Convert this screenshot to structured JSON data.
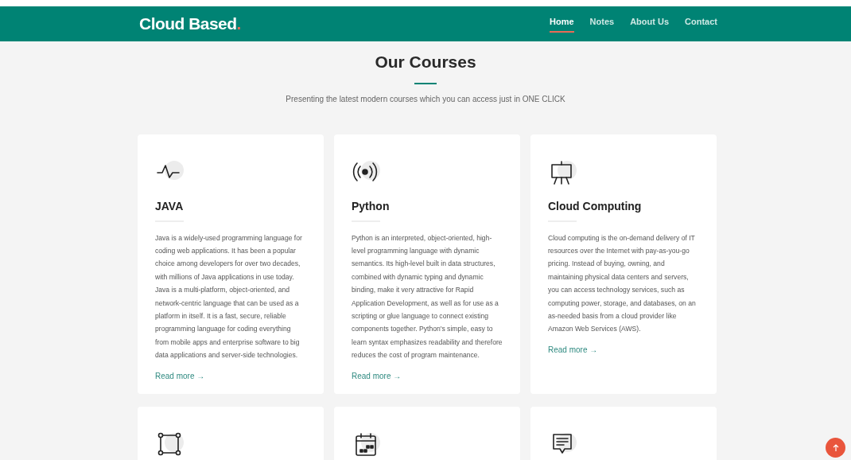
{
  "header": {
    "logo": "Cloud Based",
    "logo_dot": ".",
    "nav": [
      {
        "label": "Home",
        "selected": true
      },
      {
        "label": "Notes",
        "selected": false
      },
      {
        "label": "About Us",
        "selected": false
      },
      {
        "label": "Contact",
        "selected": false
      }
    ]
  },
  "section": {
    "title": "Our Courses",
    "subtitle": "Presenting the latest modern courses which you can access just in ONE CLICK"
  },
  "courses": [
    {
      "kind": "course",
      "title": "JAVA",
      "text": "Java is a widely-used programming language for coding web applications. It has been a popular choice among developers for over two decades, with millions of Java applications in use today. Java is a multi-platform, object-oriented, and network-centric language that can be used as a platform in itself. It is a fast, secure, reliable programming language for coding everything from mobile apps and enterprise software to big data applications and server-side technologies.",
      "link": "Read more →"
    },
    {
      "kind": "course",
      "title": "Python",
      "text": "Python is an interpreted, object-oriented, high-level programming language with dynamic semantics. Its high-level built in data structures, combined with dynamic typing and dynamic binding, make it very attractive for Rapid Application Development, as well as for use as a scripting or glue language to connect existing components together. Python's simple, easy to learn syntax emphasizes readability and therefore reduces the cost of program maintenance.",
      "link": "Read more →"
    },
    {
      "kind": "course",
      "title": "Cloud Computing",
      "text": "Cloud computing is the on-demand delivery of IT resources over the Internet with pay-as-you-go pricing. Instead of buying, owning, and maintaining physical data centers and servers, you can access technology services, such as computing power, storage, and databases, on an as-needed basis from a cloud provider like Amazon Web Services (AWS).",
      "link": "Read more →"
    },
    {
      "kind": "teaser"
    },
    {
      "kind": "teaser"
    },
    {
      "kind": "teaser"
    }
  ]
}
